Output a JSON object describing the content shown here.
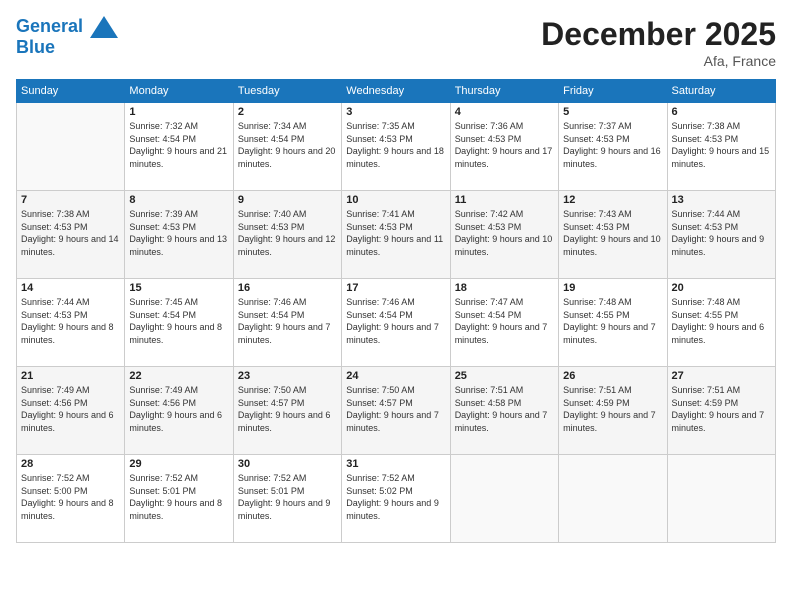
{
  "logo": {
    "line1": "General",
    "line2": "Blue"
  },
  "title": "December 2025",
  "location": "Afa, France",
  "days_header": [
    "Sunday",
    "Monday",
    "Tuesday",
    "Wednesday",
    "Thursday",
    "Friday",
    "Saturday"
  ],
  "weeks": [
    [
      {
        "day": "",
        "sunrise": "",
        "sunset": "",
        "daylight": ""
      },
      {
        "day": "1",
        "sunrise": "Sunrise: 7:32 AM",
        "sunset": "Sunset: 4:54 PM",
        "daylight": "Daylight: 9 hours and 21 minutes."
      },
      {
        "day": "2",
        "sunrise": "Sunrise: 7:34 AM",
        "sunset": "Sunset: 4:54 PM",
        "daylight": "Daylight: 9 hours and 20 minutes."
      },
      {
        "day": "3",
        "sunrise": "Sunrise: 7:35 AM",
        "sunset": "Sunset: 4:53 PM",
        "daylight": "Daylight: 9 hours and 18 minutes."
      },
      {
        "day": "4",
        "sunrise": "Sunrise: 7:36 AM",
        "sunset": "Sunset: 4:53 PM",
        "daylight": "Daylight: 9 hours and 17 minutes."
      },
      {
        "day": "5",
        "sunrise": "Sunrise: 7:37 AM",
        "sunset": "Sunset: 4:53 PM",
        "daylight": "Daylight: 9 hours and 16 minutes."
      },
      {
        "day": "6",
        "sunrise": "Sunrise: 7:38 AM",
        "sunset": "Sunset: 4:53 PM",
        "daylight": "Daylight: 9 hours and 15 minutes."
      }
    ],
    [
      {
        "day": "7",
        "sunrise": "Sunrise: 7:38 AM",
        "sunset": "Sunset: 4:53 PM",
        "daylight": "Daylight: 9 hours and 14 minutes."
      },
      {
        "day": "8",
        "sunrise": "Sunrise: 7:39 AM",
        "sunset": "Sunset: 4:53 PM",
        "daylight": "Daylight: 9 hours and 13 minutes."
      },
      {
        "day": "9",
        "sunrise": "Sunrise: 7:40 AM",
        "sunset": "Sunset: 4:53 PM",
        "daylight": "Daylight: 9 hours and 12 minutes."
      },
      {
        "day": "10",
        "sunrise": "Sunrise: 7:41 AM",
        "sunset": "Sunset: 4:53 PM",
        "daylight": "Daylight: 9 hours and 11 minutes."
      },
      {
        "day": "11",
        "sunrise": "Sunrise: 7:42 AM",
        "sunset": "Sunset: 4:53 PM",
        "daylight": "Daylight: 9 hours and 10 minutes."
      },
      {
        "day": "12",
        "sunrise": "Sunrise: 7:43 AM",
        "sunset": "Sunset: 4:53 PM",
        "daylight": "Daylight: 9 hours and 10 minutes."
      },
      {
        "day": "13",
        "sunrise": "Sunrise: 7:44 AM",
        "sunset": "Sunset: 4:53 PM",
        "daylight": "Daylight: 9 hours and 9 minutes."
      }
    ],
    [
      {
        "day": "14",
        "sunrise": "Sunrise: 7:44 AM",
        "sunset": "Sunset: 4:53 PM",
        "daylight": "Daylight: 9 hours and 8 minutes."
      },
      {
        "day": "15",
        "sunrise": "Sunrise: 7:45 AM",
        "sunset": "Sunset: 4:54 PM",
        "daylight": "Daylight: 9 hours and 8 minutes."
      },
      {
        "day": "16",
        "sunrise": "Sunrise: 7:46 AM",
        "sunset": "Sunset: 4:54 PM",
        "daylight": "Daylight: 9 hours and 7 minutes."
      },
      {
        "day": "17",
        "sunrise": "Sunrise: 7:46 AM",
        "sunset": "Sunset: 4:54 PM",
        "daylight": "Daylight: 9 hours and 7 minutes."
      },
      {
        "day": "18",
        "sunrise": "Sunrise: 7:47 AM",
        "sunset": "Sunset: 4:54 PM",
        "daylight": "Daylight: 9 hours and 7 minutes."
      },
      {
        "day": "19",
        "sunrise": "Sunrise: 7:48 AM",
        "sunset": "Sunset: 4:55 PM",
        "daylight": "Daylight: 9 hours and 7 minutes."
      },
      {
        "day": "20",
        "sunrise": "Sunrise: 7:48 AM",
        "sunset": "Sunset: 4:55 PM",
        "daylight": "Daylight: 9 hours and 6 minutes."
      }
    ],
    [
      {
        "day": "21",
        "sunrise": "Sunrise: 7:49 AM",
        "sunset": "Sunset: 4:56 PM",
        "daylight": "Daylight: 9 hours and 6 minutes."
      },
      {
        "day": "22",
        "sunrise": "Sunrise: 7:49 AM",
        "sunset": "Sunset: 4:56 PM",
        "daylight": "Daylight: 9 hours and 6 minutes."
      },
      {
        "day": "23",
        "sunrise": "Sunrise: 7:50 AM",
        "sunset": "Sunset: 4:57 PM",
        "daylight": "Daylight: 9 hours and 6 minutes."
      },
      {
        "day": "24",
        "sunrise": "Sunrise: 7:50 AM",
        "sunset": "Sunset: 4:57 PM",
        "daylight": "Daylight: 9 hours and 7 minutes."
      },
      {
        "day": "25",
        "sunrise": "Sunrise: 7:51 AM",
        "sunset": "Sunset: 4:58 PM",
        "daylight": "Daylight: 9 hours and 7 minutes."
      },
      {
        "day": "26",
        "sunrise": "Sunrise: 7:51 AM",
        "sunset": "Sunset: 4:59 PM",
        "daylight": "Daylight: 9 hours and 7 minutes."
      },
      {
        "day": "27",
        "sunrise": "Sunrise: 7:51 AM",
        "sunset": "Sunset: 4:59 PM",
        "daylight": "Daylight: 9 hours and 7 minutes."
      }
    ],
    [
      {
        "day": "28",
        "sunrise": "Sunrise: 7:52 AM",
        "sunset": "Sunset: 5:00 PM",
        "daylight": "Daylight: 9 hours and 8 minutes."
      },
      {
        "day": "29",
        "sunrise": "Sunrise: 7:52 AM",
        "sunset": "Sunset: 5:01 PM",
        "daylight": "Daylight: 9 hours and 8 minutes."
      },
      {
        "day": "30",
        "sunrise": "Sunrise: 7:52 AM",
        "sunset": "Sunset: 5:01 PM",
        "daylight": "Daylight: 9 hours and 9 minutes."
      },
      {
        "day": "31",
        "sunrise": "Sunrise: 7:52 AM",
        "sunset": "Sunset: 5:02 PM",
        "daylight": "Daylight: 9 hours and 9 minutes."
      },
      {
        "day": "",
        "sunrise": "",
        "sunset": "",
        "daylight": ""
      },
      {
        "day": "",
        "sunrise": "",
        "sunset": "",
        "daylight": ""
      },
      {
        "day": "",
        "sunrise": "",
        "sunset": "",
        "daylight": ""
      }
    ]
  ]
}
